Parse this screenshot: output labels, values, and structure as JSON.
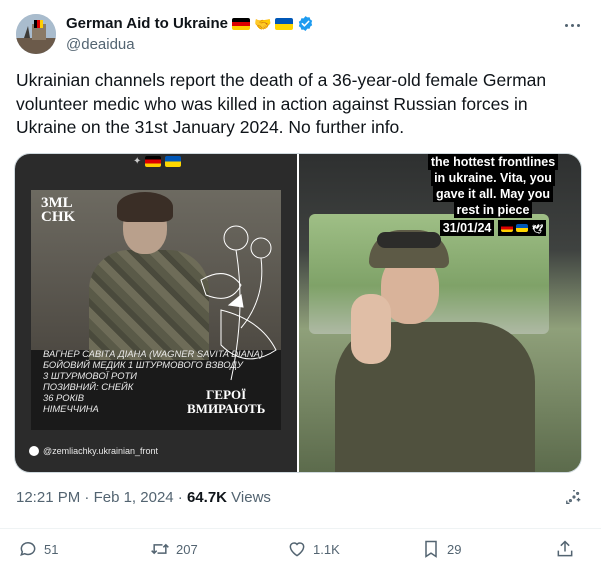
{
  "author": {
    "name": "German Aid to Ukraine",
    "handle": "@deaidua",
    "verified": true,
    "name_emojis": [
      "flag-germany",
      "handshake",
      "flag-ukraine"
    ]
  },
  "tweet": {
    "text": "Ukrainian channels report the death of a 36-year-old female German volunteer medic who was killed in action against Russian forces in Ukraine on the 31st January 2024. No further info."
  },
  "media": {
    "left": {
      "logo": "3ML CHK",
      "caption_lines": [
        "ВАГНЕР САВІТА ДІАНА (WAGNER SAVITA DIANA)",
        "БОЙОВИЙ МЕДИК 1 ШТУРМОВОГО ВЗВОДУ",
        "3 ШТУРМОВОЇ РОТИ",
        "ПОЗИВНИЙ: СНЕЙК",
        "36 РОКІВ",
        "НІМЕЧЧИНА"
      ],
      "slogan_line1": "ГЕРОЇ",
      "slogan_line2": "ВМИРАЮТЬ",
      "watermark": "@zemliachky.ukrainian_front"
    },
    "right": {
      "story_lines": [
        "the hottest frontlines",
        "in ukraine. Vita, you",
        "gave it all. May you",
        "rest in piece",
        "31/01/24"
      ]
    }
  },
  "meta": {
    "time": "12:21 PM",
    "date": "Feb 1, 2024",
    "views_count": "64.7K",
    "views_label": "Views"
  },
  "actions": {
    "replies": "51",
    "reposts": "207",
    "likes": "1.1K",
    "bookmarks": "29"
  },
  "colors": {
    "text": "#0f1419",
    "muted": "#536471",
    "verified": "#1d9bf0",
    "border": "#cfd9de"
  }
}
